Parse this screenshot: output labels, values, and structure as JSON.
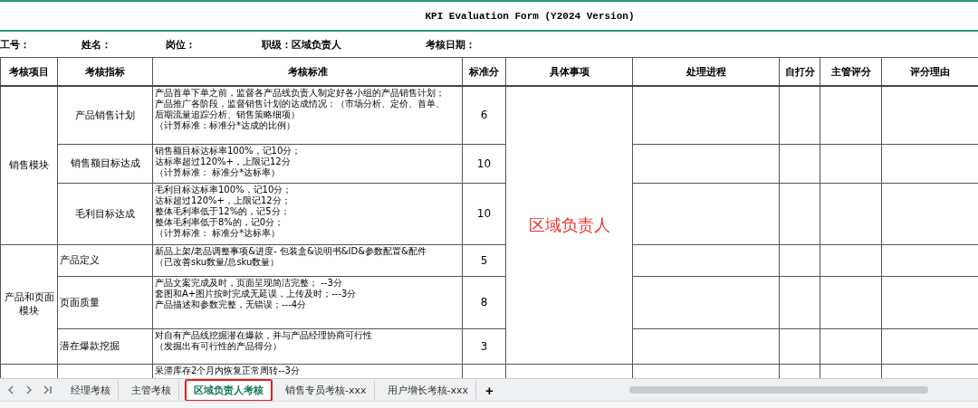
{
  "title": "KPI Evaluation Form (Y2024 Version)",
  "info_fields": [
    {
      "label": "工号："
    },
    {
      "label": "姓名："
    },
    {
      "label": "岗位："
    },
    {
      "label": "职级：区域负责人"
    },
    {
      "label": "考核日期："
    }
  ],
  "table": {
    "columns": [
      "考核项目",
      "考核指标",
      "考核标准",
      "标准分",
      "具体事项",
      "处理进程",
      "自打分",
      "主管评分",
      "评分理由"
    ],
    "detail_note": "区域负责人",
    "groups": [
      {
        "name": "销售模块",
        "rows": [
          {
            "indicator": "产品销售计划",
            "criteria": [
              "产品首单下单之前，监督各产品线负责人制定好各小组的产品销售计划；",
              "产品推广各阶段，监督销售计划的达成情况：（市场分析、定价、首单、",
              "后期流量追踪分析、销售策略细项）",
              "（计算标准：标准分*达成的比例）"
            ],
            "score": "6"
          },
          {
            "indicator": "销售额目标达成",
            "criteria": [
              "销售额目标达标率100%，记10分；",
              "达标率超过120%+，上限记12分",
              "（计算标准： 标准分*达标率）"
            ],
            "score": "10"
          },
          {
            "indicator": "毛利目标达成",
            "criteria": [
              "毛利目标达标率100%，记10分；",
              "达标超过120%+，上限记12分；",
              "整体毛利率低于12%的，记5分；",
              "整体毛利率低于8%的，记0分；",
              "（计算标准： 标准分*达标率）"
            ],
            "score": "10"
          }
        ]
      },
      {
        "name": "产品和页面模块",
        "rows": [
          {
            "indicator": "产品定义",
            "criteria": [
              "新品上架/老品调整事项&进度- 包装盒&说明书&ID&参数配置&配件",
              "（已改善sku数量/总sku数量）"
            ],
            "score": "5"
          },
          {
            "indicator": "页面质量",
            "criteria": [
              "产品文案完成及时，页面呈现简洁完整； --3分",
              "套图和A+图片按时完成无延误，上传及时；---3分",
              "产品描述和参数完整，无错误；---4分"
            ],
            "score": "8"
          },
          {
            "indicator": "潜在爆款挖掘",
            "criteria": [
              "对自有产品线挖掘潜在爆款，并与产品经理协商可行性",
              "（发掘出有可行性的产品得分）"
            ],
            "score": "3"
          }
        ]
      },
      {
        "rows": [
          {
            "criteria": [
              "呆滞库存2个月内恢复正常周转--3分"
            ]
          }
        ]
      }
    ]
  },
  "sheet_tabs": [
    {
      "label": "经理考核",
      "selected": false
    },
    {
      "label": "主管考核",
      "selected": false
    },
    {
      "label": "区域负责人考核",
      "selected": true
    },
    {
      "label": "销售专员考核-xxx",
      "selected": false
    },
    {
      "label": "用户增长考核-xxx",
      "selected": false
    }
  ],
  "add_sheet": "+"
}
